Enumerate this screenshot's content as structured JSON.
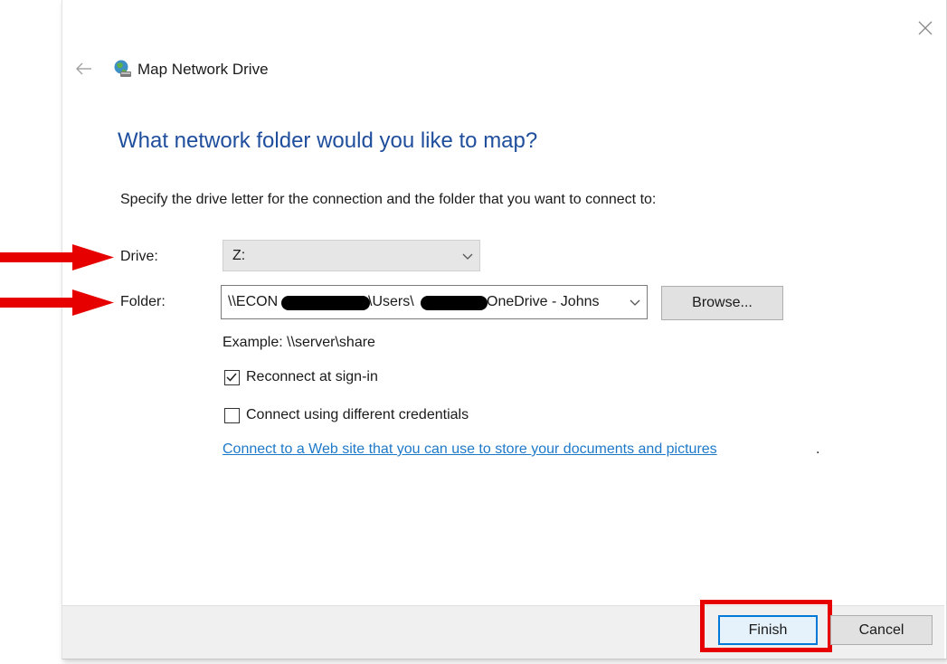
{
  "dialog": {
    "title": "Map Network Drive",
    "heading": "What network folder would you like to map?",
    "instructions": "Specify the drive letter for the connection and the folder that you want to connect to:"
  },
  "drive": {
    "label": "Drive:",
    "value": "Z:"
  },
  "folder": {
    "label": "Folder:",
    "value_parts": [
      "\\\\ECON",
      "\\Users\\",
      "OneDrive - Johns"
    ],
    "redacted_segments": 2,
    "browse_label": "Browse...",
    "example": "Example: \\\\server\\share"
  },
  "options": {
    "reconnect": {
      "label": "Reconnect at sign-in",
      "checked": true
    },
    "different_credentials": {
      "label": "Connect using different credentials",
      "checked": false
    }
  },
  "link": {
    "text": "Connect to a Web site that you can use to store your documents and pictures",
    "trailing": "."
  },
  "buttons": {
    "finish": "Finish",
    "cancel": "Cancel"
  },
  "annotations": {
    "arrow_color": "#e60000",
    "highlight_color": "#e60000"
  },
  "icons": {
    "close": "close-icon",
    "back": "back-arrow-icon",
    "title": "network-drive-icon",
    "dropdown": "chevron-down-icon"
  },
  "colors": {
    "heading": "#1f4e9d",
    "link": "#1f79c9",
    "primary_button_border": "#0078d7",
    "footer_bg": "#f0f0f0"
  }
}
